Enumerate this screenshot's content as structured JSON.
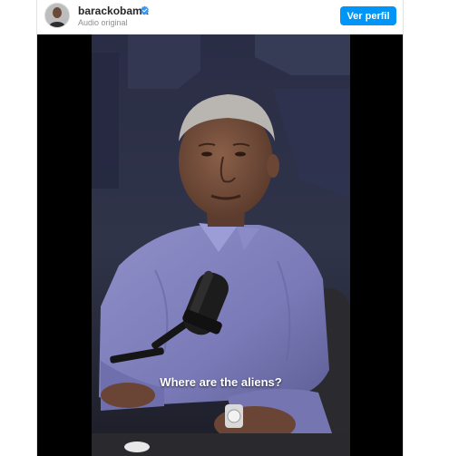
{
  "post": {
    "username": "barackobama",
    "verified": true,
    "audio_label": "Audio original",
    "profile_button": "Ver perfil"
  },
  "video": {
    "caption": "Where are the aliens?"
  },
  "colors": {
    "accent": "#0095f6",
    "verified_badge": "#3897f0",
    "letterbox": "#000000"
  },
  "icons": {
    "verified": "verified-badge-icon",
    "avatar": "profile-avatar"
  }
}
